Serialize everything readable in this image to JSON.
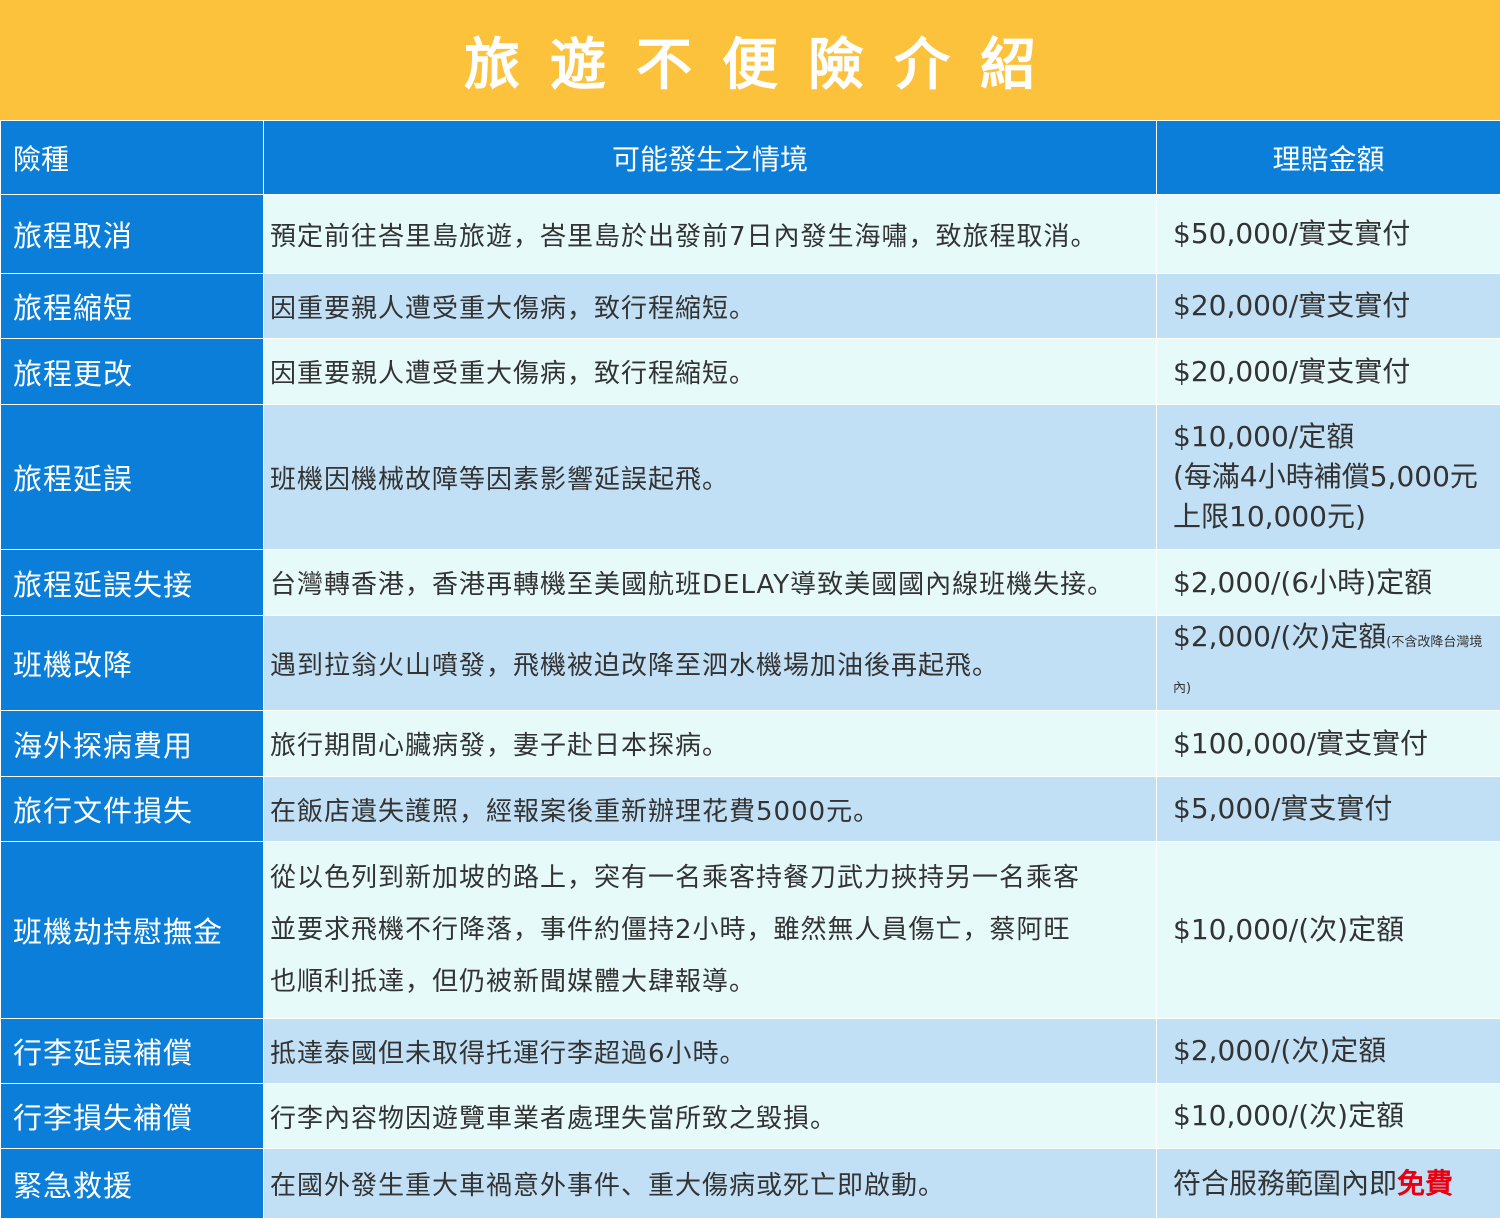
{
  "title": "旅遊不便險介紹",
  "header": {
    "col1": "險種",
    "col2": "可能發生之情境",
    "col3": "理賠金額"
  },
  "rows": [
    {
      "type": "旅程取消",
      "scenario": "預定前往峇里島旅遊，峇里島於出發前7日內發生海嘯，致旅程取消。",
      "amount": "$50,000/實支實付"
    },
    {
      "type": "旅程縮短",
      "scenario": "因重要親人遭受重大傷病，致行程縮短。",
      "amount": "$20,000/實支實付"
    },
    {
      "type": "旅程更改",
      "scenario": "因重要親人遭受重大傷病，致行程縮短。",
      "amount": "$20,000/實支實付"
    },
    {
      "type": "旅程延誤",
      "scenario": "班機因機械故障等因素影響延誤起飛。",
      "amount_lines": [
        "$10,000/定額",
        "(每滿4小時補償5,000元",
        "上限10,000元)"
      ]
    },
    {
      "type": "旅程延誤失接",
      "scenario": "台灣轉香港，香港再轉機至美國航班DELAY導致美國國內線班機失接。",
      "amount": "$2,000/(6小時)定額"
    },
    {
      "type": "班機改降",
      "scenario": "遇到拉翁火山噴發，飛機被迫改降至泗水機場加油後再起飛。",
      "amount": "$2,000/(次)定額",
      "amount_note": "(不含改降台灣境內)"
    },
    {
      "type": "海外探病費用",
      "scenario": "旅行期間心臟病發，妻子赴日本探病。",
      "amount": "$100,000/實支實付"
    },
    {
      "type": "旅行文件損失",
      "scenario": "在飯店遺失護照，經報案後重新辦理花費5000元。",
      "amount": "$5,000/實支實付"
    },
    {
      "type": "班機劫持慰撫金",
      "scenario_lines": [
        "從以色列到新加坡的路上，突有一名乘客持餐刀武力挾持另一名乘客",
        "並要求飛機不行降落，事件約僵持2小時，雖然無人員傷亡，蔡阿旺",
        "也順利抵達，但仍被新聞媒體大肆報導。"
      ],
      "amount": "$10,000/(次)定額"
    },
    {
      "type": "行李延誤補償",
      "scenario": "抵達泰國但未取得托運行李超過6小時。",
      "amount": "$2,000/(次)定額"
    },
    {
      "type": "行李損失補償",
      "scenario": "行李內容物因遊覽車業者處理失當所致之毀損。",
      "amount": "$10,000/(次)定額"
    },
    {
      "type": "緊急救援",
      "scenario": "在國外發生重大車禍意外事件、重大傷病或死亡即啟動。",
      "amount": "符合服務範圍內即",
      "amount_highlight": "免費"
    }
  ],
  "colors": {
    "banner": "#fcc23b",
    "header_blue": "#0a7ed9",
    "row_light": "#e6fafa",
    "row_blue": "#c2e0f5",
    "highlight_red": "#e60012"
  }
}
